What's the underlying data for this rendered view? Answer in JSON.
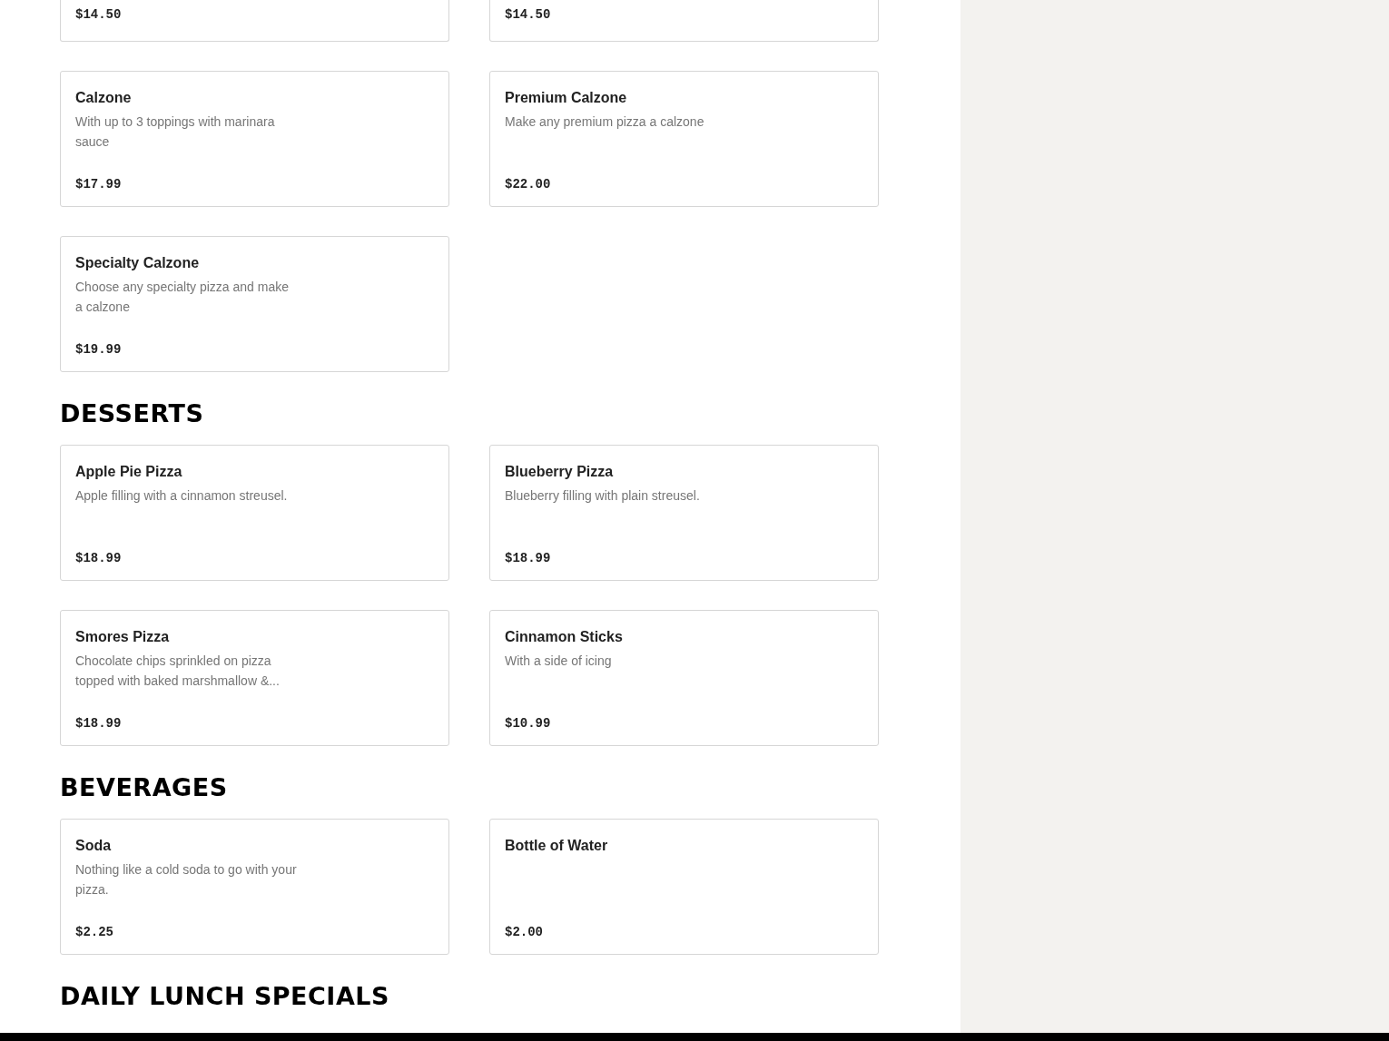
{
  "top_cards": [
    {
      "price": "$14.50"
    },
    {
      "price": "$14.50"
    }
  ],
  "sections": [
    {
      "items": [
        {
          "name": "Calzone",
          "description": "With up to 3 toppings with marinara sauce",
          "price": "$17.99"
        },
        {
          "name": "Premium Calzone",
          "description": "Make any premium pizza a calzone",
          "price": "$22.00"
        },
        {
          "name": "Specialty Calzone",
          "description": "Choose any specialty pizza and make a calzone",
          "price": "$19.99"
        }
      ]
    },
    {
      "heading": "DESSERTS",
      "items": [
        {
          "name": "Apple Pie Pizza",
          "description": "Apple filling with a cinnamon streusel.",
          "price": "$18.99"
        },
        {
          "name": "Blueberry Pizza",
          "description": "Blueberry filling with plain streusel.",
          "price": "$18.99"
        },
        {
          "name": "Smores Pizza",
          "description": "Chocolate chips sprinkled on pizza topped with baked marshmallow &...",
          "price": "$18.99"
        },
        {
          "name": "Cinnamon Sticks",
          "description": "With a side of icing",
          "price": "$10.99"
        }
      ]
    },
    {
      "heading": "BEVERAGES",
      "items": [
        {
          "name": "Soda",
          "description": "Nothing like a cold soda to go with your pizza.",
          "price": "$2.25"
        },
        {
          "name": "Bottle of Water",
          "price": "$2.00"
        }
      ]
    },
    {
      "heading": "DAILY LUNCH SPECIALS"
    }
  ]
}
